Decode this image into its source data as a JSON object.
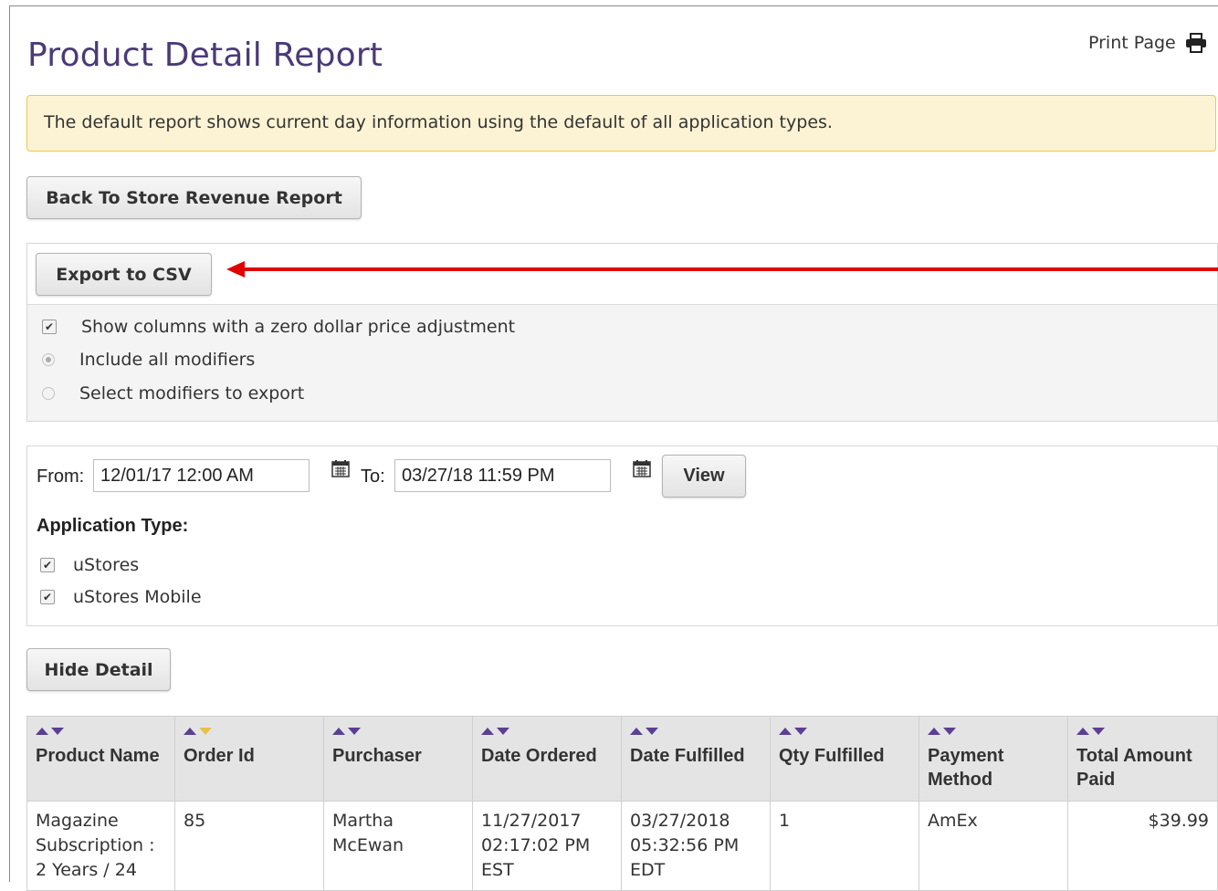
{
  "page": {
    "title": "Product Detail Report",
    "print_label": "Print Page",
    "notice": "The default report shows current day information using the default of all application types."
  },
  "buttons": {
    "back": "Back To Store Revenue Report",
    "export": "Export to CSV",
    "view": "View",
    "hide_detail": "Hide Detail"
  },
  "export_options": {
    "zero_dollar": {
      "label": "Show columns with a zero dollar price adjustment",
      "checked": true
    },
    "include_all": {
      "label": "Include all modifiers",
      "selected": true
    },
    "select_modifiers": {
      "label": "Select modifiers to export",
      "selected": false
    }
  },
  "filter": {
    "from_label": "From:",
    "from_value": "12/01/17 12:00 AM",
    "to_label": "To:",
    "to_value": "03/27/18 11:59 PM",
    "app_type_label": "Application Type:",
    "app_types": [
      {
        "label": "uStores",
        "checked": true
      },
      {
        "label": "uStores Mobile",
        "checked": true
      }
    ]
  },
  "table": {
    "headers": [
      [
        "Product Name"
      ],
      [
        "Order Id"
      ],
      [
        "Purchaser"
      ],
      [
        "Date Ordered"
      ],
      [
        "Date Fulfilled"
      ],
      [
        "Qty Fulfilled"
      ],
      [
        "Payment",
        "Method"
      ],
      [
        "Total Amount",
        "Paid"
      ]
    ],
    "rows": [
      {
        "product_name": [
          "Magazine",
          "Subscription :",
          "2 Years / 24"
        ],
        "order_id": "85",
        "purchaser": [
          "Martha",
          "McEwan"
        ],
        "date_ordered": [
          "11/27/2017",
          "02:17:02 PM",
          "EST"
        ],
        "date_fulfilled": [
          "03/27/2018",
          "05:32:56 PM",
          "EDT"
        ],
        "qty_fulfilled": "1",
        "payment_method": "AmEx",
        "total_paid": "$39.99"
      }
    ]
  },
  "colors": {
    "title": "#4b3a78",
    "notice_bg": "#fcf3d4",
    "notice_border": "#f0c64b",
    "sort_arrow": "#5b3f94",
    "sort_active": "#e7c04a",
    "annotation_arrow": "#e00000"
  },
  "icons": {
    "print": "printer-icon",
    "calendar": "calendar-icon",
    "sort": "sort-arrows-icon"
  }
}
